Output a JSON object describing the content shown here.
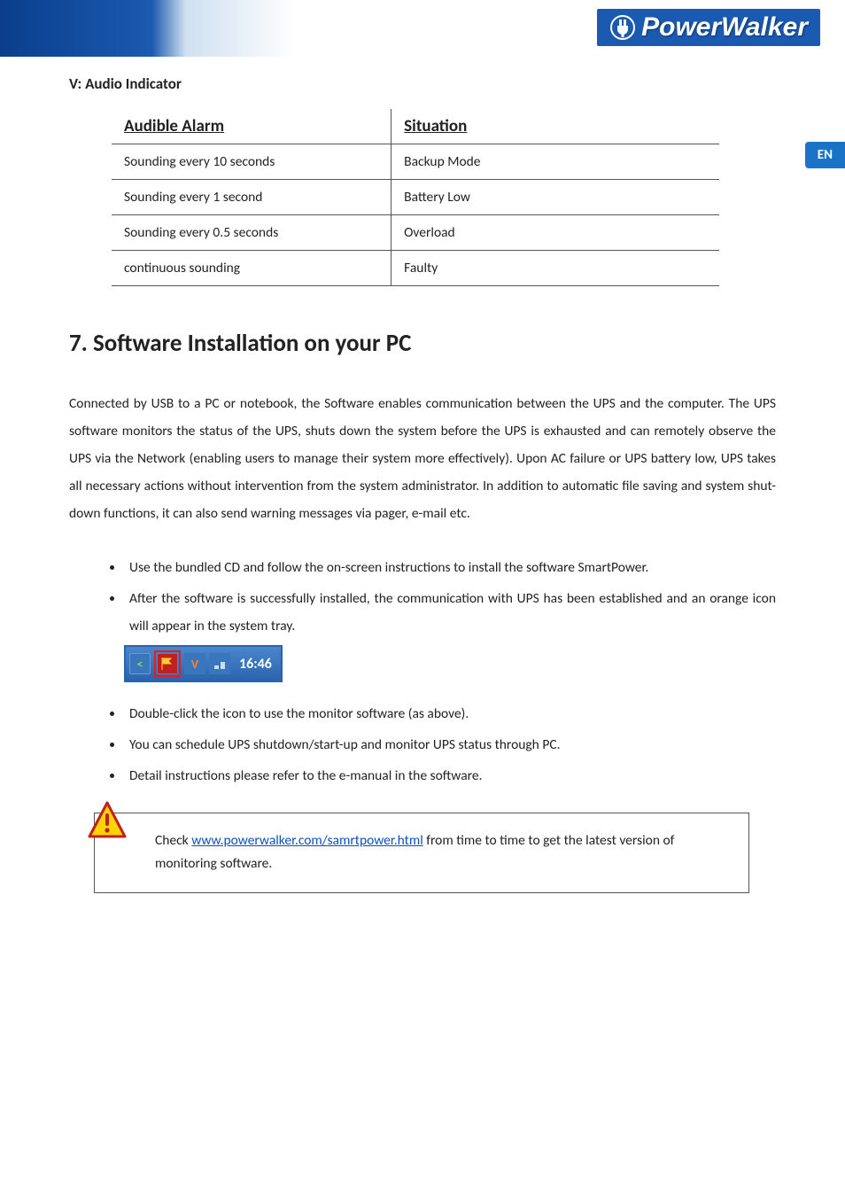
{
  "brand": "PowerWalker",
  "language_tab": "EN",
  "section_v_title": "V: Audio Indicator",
  "table": {
    "head_alarm": "Audible Alarm",
    "head_situation": "Situation",
    "rows": [
      {
        "alarm": "Sounding every 10 seconds",
        "situation": "Backup Mode"
      },
      {
        "alarm": "Sounding every 1 second",
        "situation": "Battery Low"
      },
      {
        "alarm": "Sounding every 0.5 seconds",
        "situation": "Overload"
      },
      {
        "alarm": "continuous sounding",
        "situation": "Faulty"
      }
    ]
  },
  "section7_title": "7. Software Installation on your PC",
  "paragraph": "Connected by USB to a PC or notebook, the Software enables communication between the UPS and the computer. The UPS software monitors the status of the UPS, shuts down the system before the UPS is exhausted and can remotely observe the UPS via the Network (enabling users to manage their system more effectively). Upon AC failure or UPS battery low, UPS takes all necessary actions without intervention from the system administrator. In addition to automatic file saving and system shut-down functions, it can also send warning messages via pager, e-mail etc.",
  "bullets_a": [
    "Use the bundled CD and follow the on-screen instructions to install the software SmartPower.",
    "After the software is successfully installed, the communication with UPS has been established and an orange icon will appear in the system tray."
  ],
  "tray": {
    "chevron": "<",
    "flag": "",
    "v": "V",
    "time": "16:46"
  },
  "bullets_b": [
    "Double-click the icon to use the monitor software (as above).",
    "You can schedule UPS shutdown/start-up and monitor UPS status through PC.",
    "Detail instructions please refer to the e-manual in the software."
  ],
  "note": {
    "prefix": " Check ",
    "link_text": "www.powerwalker.com/samrtpower.html",
    "suffix": " from time to time to get the latest version of monitoring software."
  }
}
